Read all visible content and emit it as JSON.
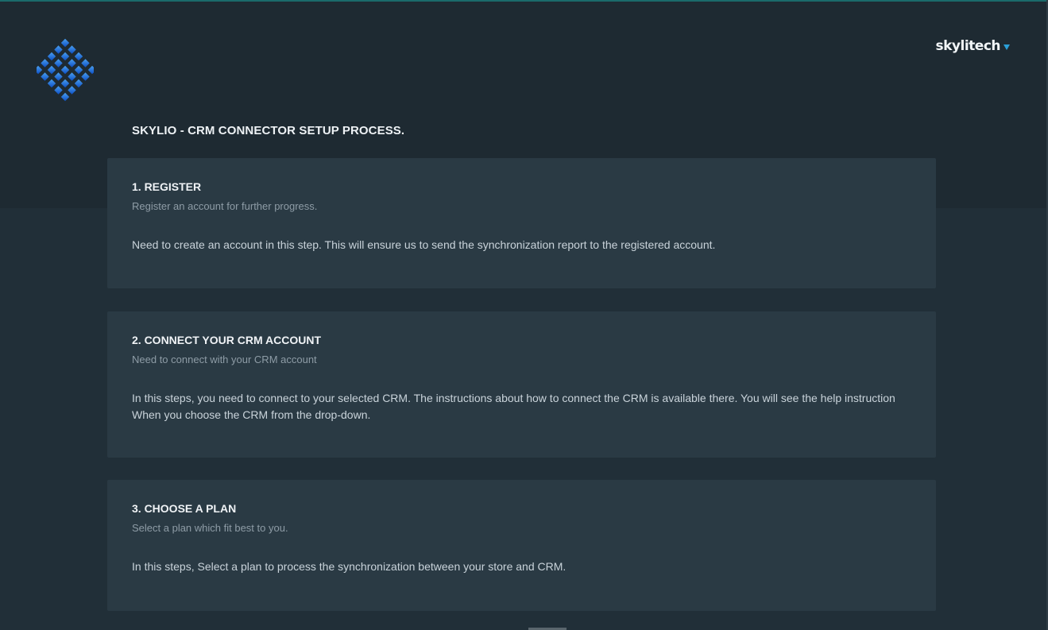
{
  "header": {
    "username": "skylitech",
    "logo_icon": "diamond-grid-logo-icon",
    "dropdown_icon": "chevron-down-icon"
  },
  "page": {
    "title": "SKYLIO - CRM CONNECTOR SETUP PROCESS."
  },
  "steps": [
    {
      "title": "1. REGISTER",
      "subtitle": "Register an account for further progress.",
      "body": "Need to create an account in this step. This will ensure us to send the synchronization report to the registered account."
    },
    {
      "title": "2. CONNECT YOUR CRM ACCOUNT",
      "subtitle": "Need to connect with your CRM account",
      "body": "In this steps, you need to connect to your selected CRM. The instructions about how to connect the CRM is available there. You will see the help instruction When you choose the CRM from the drop-down."
    },
    {
      "title": "3. CHOOSE A PLAN",
      "subtitle": "Select a plan which fit best to you.",
      "body": "In this steps, Select a plan to process the synchronization between your store and CRM."
    }
  ],
  "colors": {
    "background": "#212f38",
    "header_band": "#1e2a32",
    "card": "#2a3a44",
    "accent": "#2a9fd8",
    "logo_blue": "#1f6fd6"
  }
}
